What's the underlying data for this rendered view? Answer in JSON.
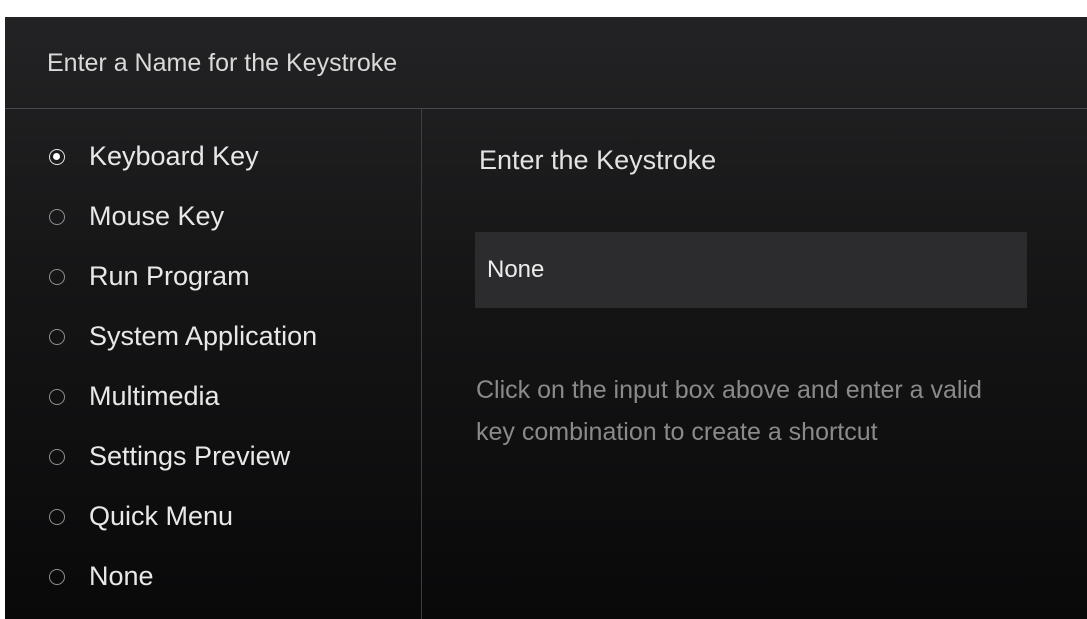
{
  "dialog": {
    "title": "Enter a Name for the Keystroke"
  },
  "options": [
    {
      "label": "Keyboard Key",
      "selected": true
    },
    {
      "label": "Mouse Key",
      "selected": false
    },
    {
      "label": "Run Program",
      "selected": false
    },
    {
      "label": "System Application",
      "selected": false
    },
    {
      "label": "Multimedia",
      "selected": false
    },
    {
      "label": "Settings Preview",
      "selected": false
    },
    {
      "label": "Quick Menu",
      "selected": false
    },
    {
      "label": "None",
      "selected": false
    }
  ],
  "keystroke": {
    "heading": "Enter the Keystroke",
    "value": "None",
    "hint": "Click on the input box above and enter a valid key combination to create a shortcut"
  }
}
